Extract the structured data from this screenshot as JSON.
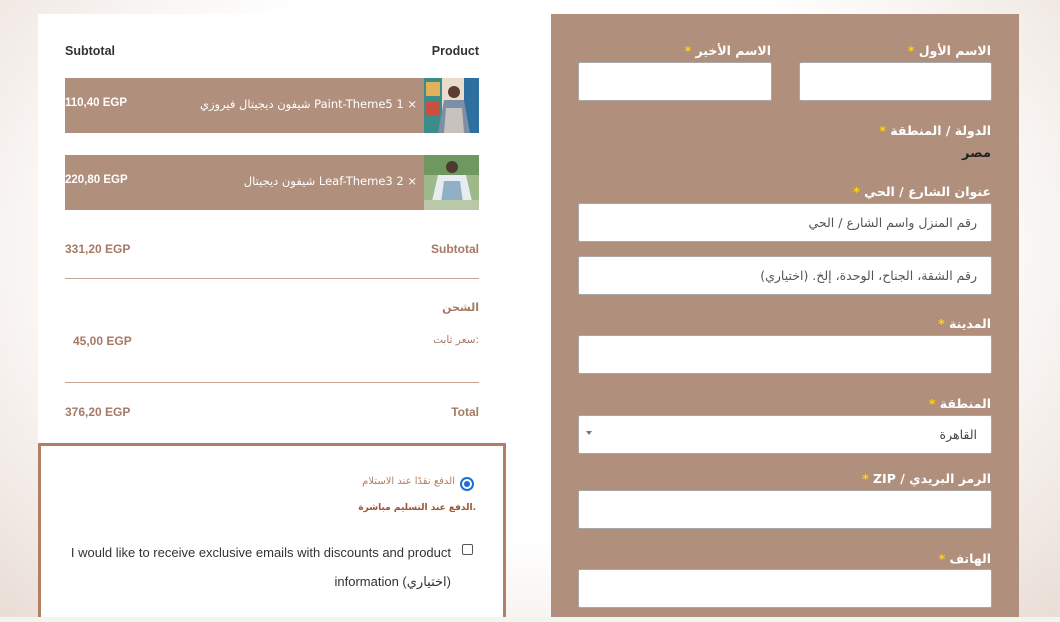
{
  "order": {
    "head_subtotal": "Subtotal",
    "head_product": "Product",
    "items": [
      {
        "price": "110,40 EGP",
        "name": "شيفون ديجيتال فيروزي Paint-Theme5",
        "qty": "1 ×",
        "thumb_icon": "product-photo-1"
      },
      {
        "price": "220,80 EGP",
        "name": "شيفون ديجيتال Leaf-Theme3",
        "qty": "2 ×",
        "thumb_icon": "product-photo-2"
      }
    ],
    "subtotal_value": "331,20 EGP",
    "subtotal_label": "Subtotal",
    "shipping_title": "الشحن",
    "shipping_method": "سعر ثابت:",
    "shipping_value": "45,00 EGP",
    "total_value": "376,20 EGP",
    "total_label": "Total"
  },
  "payment": {
    "cod_label": "الدفع نقدًا عند الاستلام",
    "cod_desc": "الدفع عند التسليم مباشرة.",
    "newsletter_text": "I would like to receive exclusive emails with discounts and product information (اختياري)"
  },
  "billing": {
    "first_name_label": "الاسم الأول",
    "last_name_label": "الاسم الأخير",
    "country_label": "الدولة / المنطقة",
    "country_value": "مصر",
    "street_label": "عنوان الشارع / الحي",
    "street_placeholder": "رقم المنزل واسم الشارع / الحي",
    "apartment_placeholder": "رقم الشقة، الجناح، الوحدة، إلخ. (اختياري)",
    "city_label": "المدينة",
    "region_label": "المنطقة",
    "region_value": "القاهرة",
    "zip_label": "الرمز البريدي / ZIP",
    "phone_label": "الهاتف",
    "required_mark": "*"
  },
  "colors": {
    "accent": "#b08f7d",
    "accent_text": "#a57a65",
    "required_star": "#ffd500",
    "radio": "#1a6fd6"
  }
}
